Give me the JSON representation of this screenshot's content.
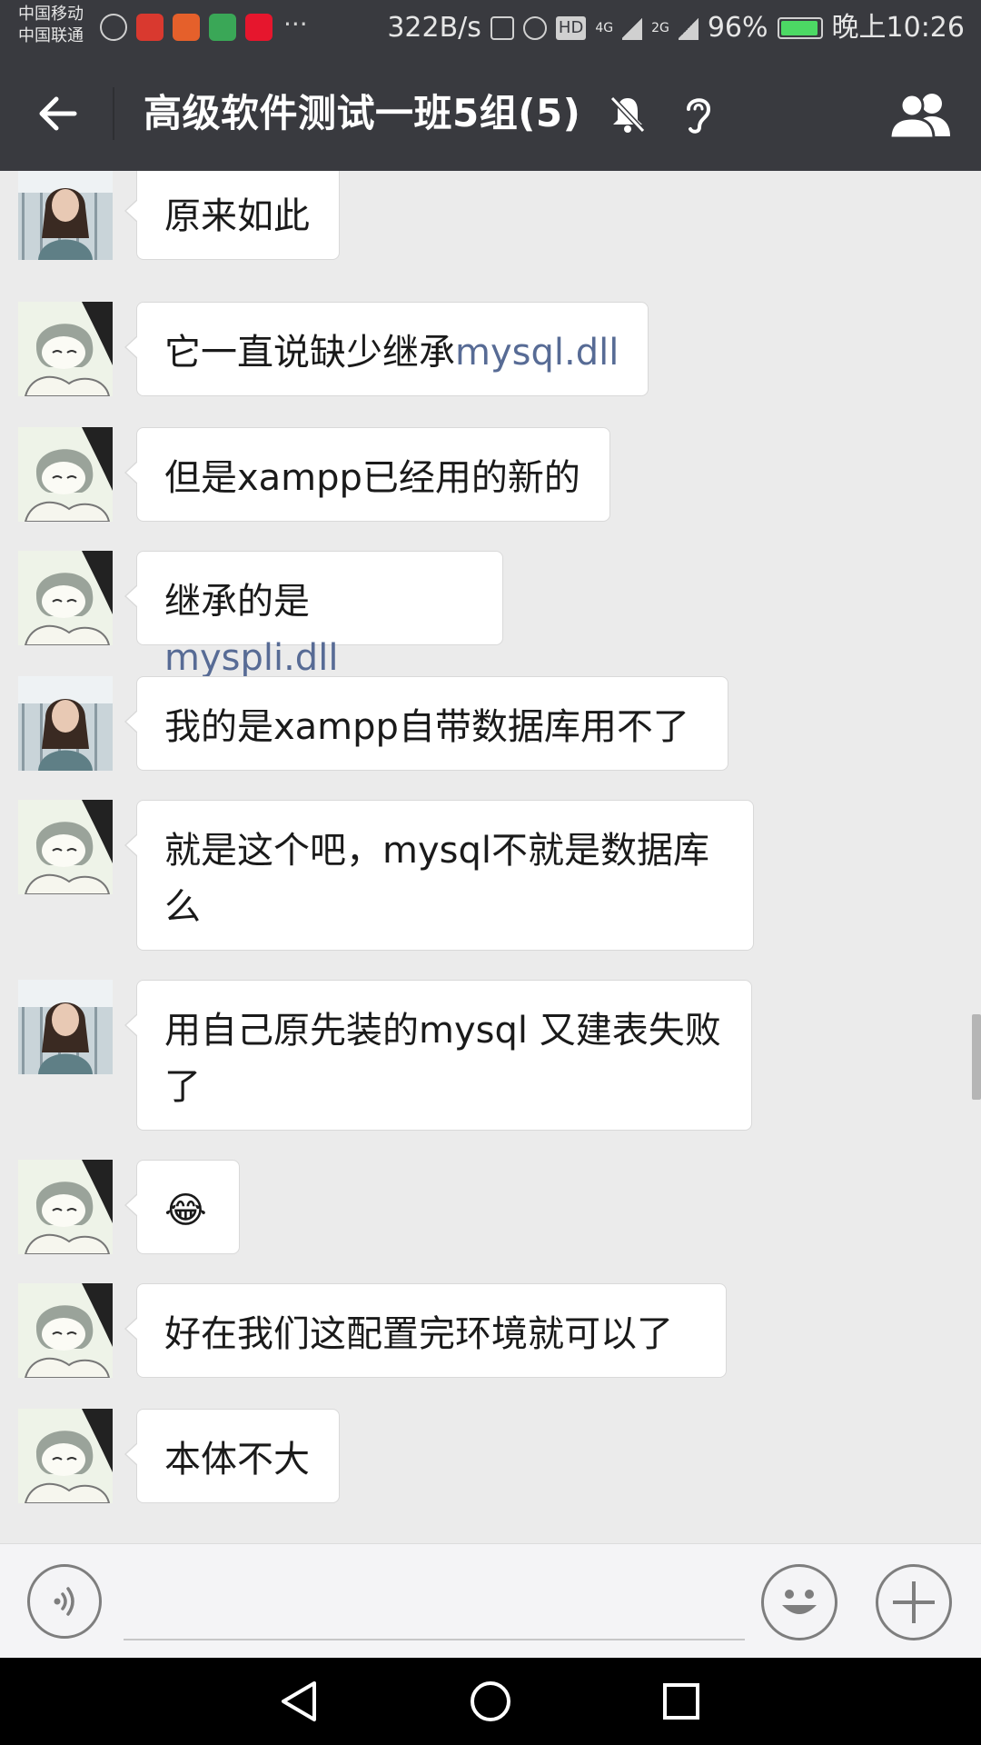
{
  "status_bar": {
    "carrier_1": "中国移动",
    "carrier_2": "中国联通",
    "speed": "322B/s",
    "hd": "HD",
    "net1": "4G",
    "net2": "2G",
    "battery": "96%",
    "battery_level": 0.96,
    "time": "晚上10:26"
  },
  "header": {
    "title": "高级软件测试一班5组(5)"
  },
  "messages": [
    {
      "avatar": "photo",
      "parts": [
        {
          "t": "原来如此"
        }
      ]
    },
    {
      "avatar": "anime",
      "parts": [
        {
          "t": "它一直说缺少继承"
        },
        {
          "t": "mysql.dll",
          "link": true
        }
      ]
    },
    {
      "avatar": "anime",
      "parts": [
        {
          "t": "但是xampp已经用的新的"
        }
      ]
    },
    {
      "avatar": "anime",
      "parts": [
        {
          "t": "继承的是"
        },
        {
          "t": "myspli.dll",
          "link": true
        }
      ]
    },
    {
      "avatar": "photo",
      "parts": [
        {
          "t": "我的是xampp自带数据库用不了"
        }
      ]
    },
    {
      "avatar": "anime",
      "parts": [
        {
          "t": "就是这个吧，mysql不就是数据库么"
        }
      ]
    },
    {
      "avatar": "photo",
      "parts": [
        {
          "t": "用自己原先装的mysql 又建表失败了"
        }
      ]
    },
    {
      "avatar": "anime",
      "parts": [
        {
          "t": "😂"
        }
      ]
    },
    {
      "avatar": "anime",
      "parts": [
        {
          "t": "好在我们这配置完环境就可以了"
        }
      ]
    },
    {
      "avatar": "anime",
      "parts": [
        {
          "t": "本体不大"
        }
      ]
    }
  ],
  "input": {
    "value": ""
  },
  "colors": {
    "bar": "#393a3f",
    "background": "#ebebeb",
    "link": "#576b95"
  }
}
